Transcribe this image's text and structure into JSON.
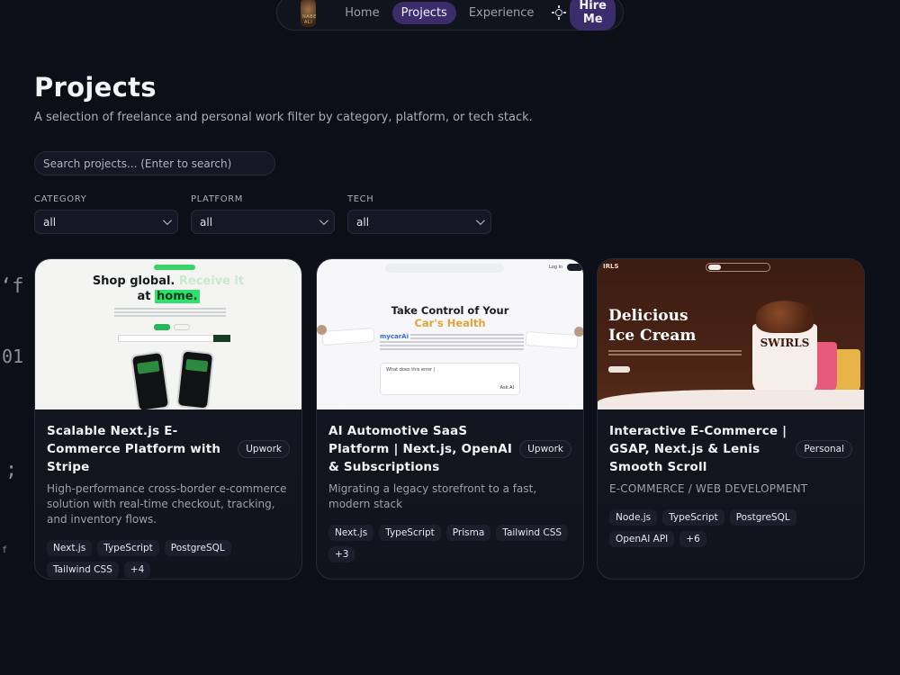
{
  "nav": {
    "logo_text": "NABEEL ALI",
    "items": [
      {
        "label": "Home"
      },
      {
        "label": "Projects"
      },
      {
        "label": "Experience"
      }
    ],
    "hire_label": "Hire Me"
  },
  "header": {
    "title": "Projects",
    "subtitle": "A selection of freelance and personal work filter by category, platform, or tech stack."
  },
  "search": {
    "placeholder": "Search projects... (Enter to search)"
  },
  "filters": {
    "category": {
      "label": "CATEGORY",
      "value": "all"
    },
    "platform": {
      "label": "PLATFORM",
      "value": "all"
    },
    "tech": {
      "label": "TECH",
      "value": "all"
    }
  },
  "background_glyphs": [
    "‘f",
    "01",
    ";",
    "f"
  ],
  "cards": [
    {
      "title": "Scalable Next.js E-Commerce Platform with Stripe",
      "badge": "Upwork",
      "description": "High-performance cross-border e-commerce solution with real-time checkout, tracking, and inventory flows.",
      "tags": [
        "Next.js",
        "TypeScript",
        "PostgreSQL",
        "Tailwind CSS",
        "+4"
      ],
      "thumb": {
        "headline_a": "Shop global.",
        "headline_b": "Receive it",
        "headline_c": "at",
        "headline_d": "home."
      }
    },
    {
      "title": "AI Automotive SaaS Platform | Next.js, OpenAI & Subscriptions",
      "badge": "Upwork",
      "description": "Migrating a legacy storefront to a fast, modern stack",
      "tags": [
        "Next.js",
        "TypeScript",
        "Prisma",
        "Tailwind CSS",
        "+3"
      ],
      "thumb": {
        "headline_a": "Take Control of Your",
        "headline_b": "Car's Health",
        "brand": "mycarAi",
        "chat_placeholder": "What does this error |",
        "chat_button": "Ask AI",
        "login": "Log In"
      }
    },
    {
      "title": "Interactive E-Commerce | GSAP, Next.js & Lenis Smooth Scroll",
      "badge": "Personal",
      "description": "E-COMMERCE / WEB DEVELOPMENT",
      "tags": [
        "Node.js",
        "TypeScript",
        "PostgreSQL",
        "OpenAI API",
        "+6"
      ],
      "thumb": {
        "brand": "IRLS",
        "headline_a": "Delicious",
        "headline_b": "Ice Cream",
        "cup_label": "SWIRLS"
      }
    }
  ],
  "colors": {
    "background": "#0c0f17",
    "accent": "#3b2d6b",
    "card_border": "#262b38",
    "muted_text": "#9aa0ad"
  }
}
